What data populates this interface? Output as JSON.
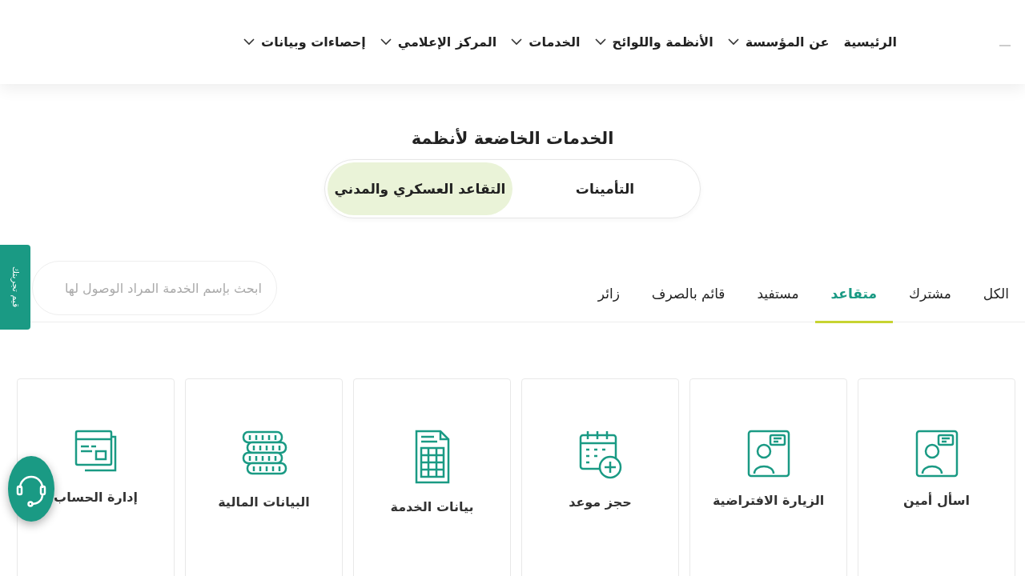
{
  "nav": {
    "items": [
      {
        "label": "الرئيسية",
        "dropdown": false
      },
      {
        "label": "عن المؤسسة",
        "dropdown": true
      },
      {
        "label": "الأنظمة واللوائح",
        "dropdown": true
      },
      {
        "label": "الخدمات",
        "dropdown": true
      },
      {
        "label": "المركز الإعلامي",
        "dropdown": true
      },
      {
        "label": "إحصاءات وبيانات",
        "dropdown": true
      }
    ]
  },
  "section_title": "الخدمات الخاضعة لأنظمة",
  "system_toggle": [
    {
      "label": "التأمينات",
      "selected": false
    },
    {
      "label": "التقاعد العسكري والمدني",
      "selected": true
    }
  ],
  "filter_tabs": [
    {
      "label": "الكل",
      "selected": false
    },
    {
      "label": "مشترك",
      "selected": false
    },
    {
      "label": "متقاعد",
      "selected": true
    },
    {
      "label": "مستفيد",
      "selected": false
    },
    {
      "label": "قائم بالصرف",
      "selected": false
    },
    {
      "label": "زائر",
      "selected": false
    }
  ],
  "search": {
    "placeholder": "ابحث بإسم الخدمة المراد الوصول لها"
  },
  "services": [
    {
      "label": "اسأل أمين",
      "kind": "agent"
    },
    {
      "label": "الزيارة الافتراضية",
      "kind": "agent"
    },
    {
      "label": "حجز موعد",
      "kind": "calendar"
    },
    {
      "label": "بيانات الخدمة",
      "kind": "sheet"
    },
    {
      "label": "البيانات المالية",
      "kind": "coins"
    },
    {
      "label": "إدارة الحساب",
      "kind": "cards"
    }
  ],
  "feedback_tab": "قيم تجربتك"
}
